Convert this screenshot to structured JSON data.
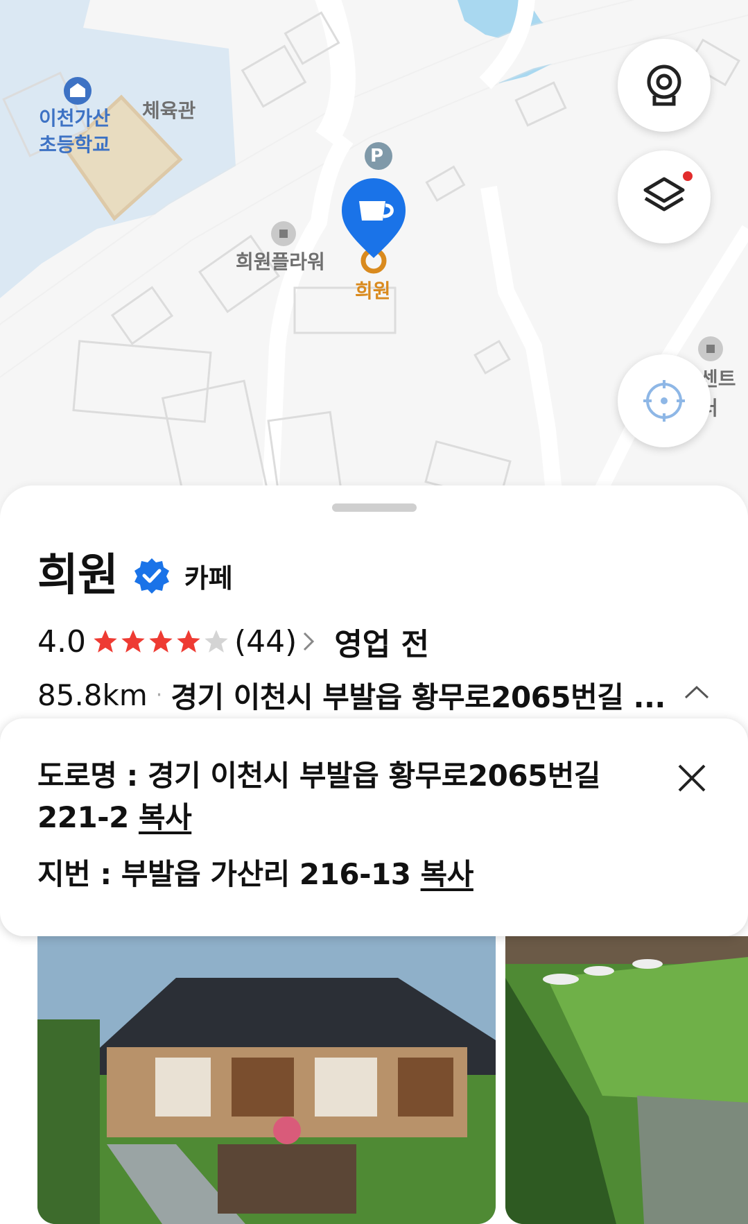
{
  "map": {
    "labels": {
      "school": "이천가산\n초등학교",
      "gym": "체육관",
      "flower": "희원플라워",
      "cafe_pin": "희원",
      "center": "센트\n터",
      "parking": "P"
    },
    "colors": {
      "pin": "#1a73e8",
      "school_label": "#3d72c4",
      "cafe_label": "#d98a1e",
      "water": "#a9d8f0"
    }
  },
  "controls": {
    "street_view_icon": "street-view-icon",
    "layers_icon": "layers-icon",
    "locate_icon": "locate-icon"
  },
  "place": {
    "name": "희원",
    "category": "카페",
    "rating": "4.0",
    "rating_value": 4.0,
    "review_count": "(44)",
    "hours_status": "영업 전",
    "distance": "85.8km",
    "address_short": "경기 이천시 부발읍 황무로2065번길 ..."
  },
  "address_popup": {
    "road_line1": "도로명 : 경기 이천시 부발읍 황무로2065번길",
    "road_line2": "221-2",
    "jibun": "지번 : 부발읍 가산리 216-13",
    "copy_label": "복사"
  }
}
